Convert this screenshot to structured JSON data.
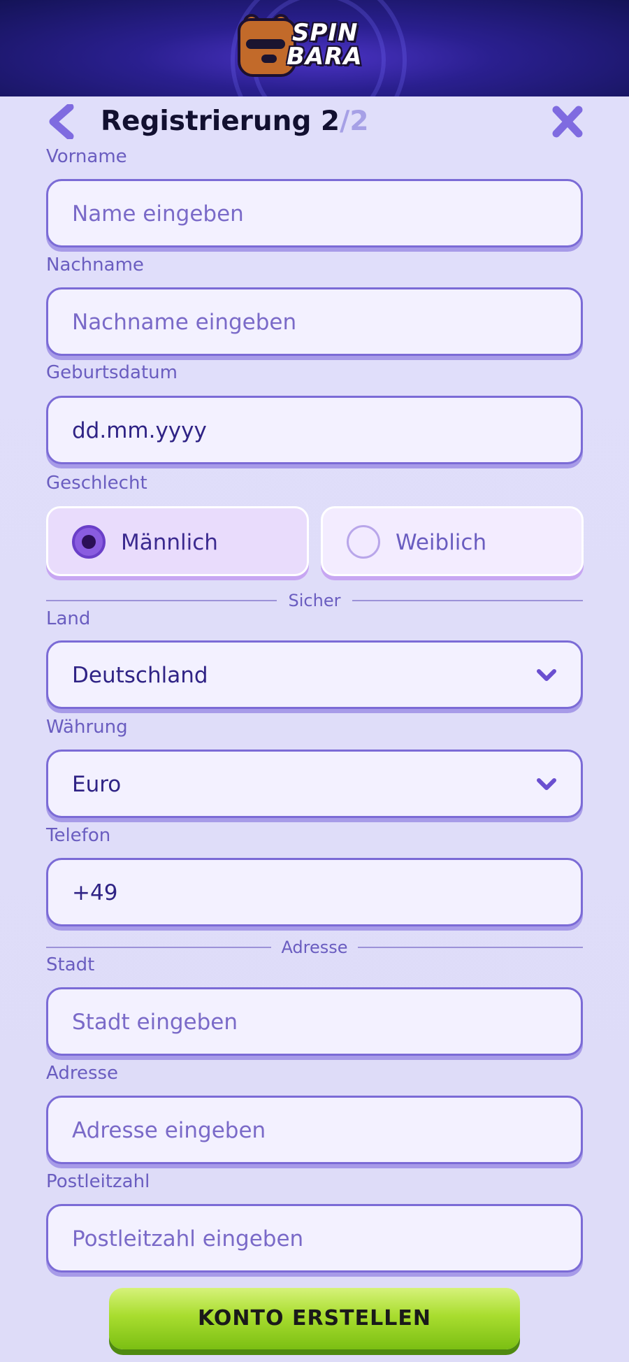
{
  "brand": {
    "line1": "SPIN",
    "line2": "BARA"
  },
  "header": {
    "title": "Registrierung 2",
    "total": "/2"
  },
  "fields": {
    "first_name": {
      "label": "Vorname",
      "placeholder": "Name eingeben"
    },
    "last_name": {
      "label": "Nachname",
      "placeholder": "Nachname eingeben"
    },
    "birthdate": {
      "label": "Geburtsdatum",
      "placeholder": "dd.mm.yyyy"
    },
    "gender": {
      "label": "Geschlecht",
      "options": [
        "Männlich",
        "Weiblich"
      ],
      "selected": "Männlich"
    },
    "country": {
      "label": "Land",
      "value": "Deutschland"
    },
    "currency": {
      "label": "Währung",
      "value": "Euro"
    },
    "phone": {
      "label": "Telefon",
      "value": "+49"
    },
    "city": {
      "label": "Stadt",
      "placeholder": "Stadt eingeben"
    },
    "address": {
      "label": "Adresse",
      "placeholder": "Adresse eingeben"
    },
    "postal": {
      "label": "Postleitzahl",
      "placeholder": "Postleitzahl eingeben"
    }
  },
  "dividers": {
    "secure": "Sicher",
    "address": "Adresse"
  },
  "cta": {
    "label": "KONTO ERSTELLEN"
  },
  "colors": {
    "accent": "#7b6bd6",
    "cta": "#a9dd2f",
    "topbar": "#1b1766"
  }
}
